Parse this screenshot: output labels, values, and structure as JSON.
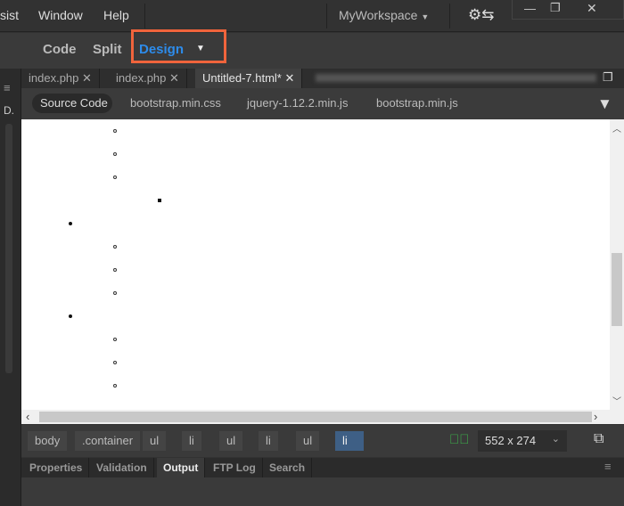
{
  "menu": {
    "items": [
      "sist",
      "Window",
      "Help"
    ],
    "workspace": "MyWorkspace"
  },
  "view": {
    "code": "Code",
    "split": "Split",
    "design": "Design"
  },
  "tabs": [
    {
      "label": "index.php"
    },
    {
      "label": "index.php"
    },
    {
      "label": "Untitled-7.html*"
    }
  ],
  "related_files": [
    "Source Code",
    "bootstrap.min.css",
    "jquery-1.12.2.min.js",
    "bootstrap.min.js"
  ],
  "tag_selector": [
    "body",
    ".container",
    "ul",
    "li",
    "ul",
    "li",
    "ul",
    "li"
  ],
  "viewport_size": "552 x 274",
  "panel_tabs": [
    "Properties",
    "Validation",
    "Output",
    "FTP Log",
    "Search"
  ],
  "left_panel_letters": [
    "D."
  ],
  "colors": {
    "accent": "#2d8ceb",
    "highlight_box": "#f0643c",
    "selected_tag": "#3e5f85",
    "valid": "#3cb44b"
  }
}
